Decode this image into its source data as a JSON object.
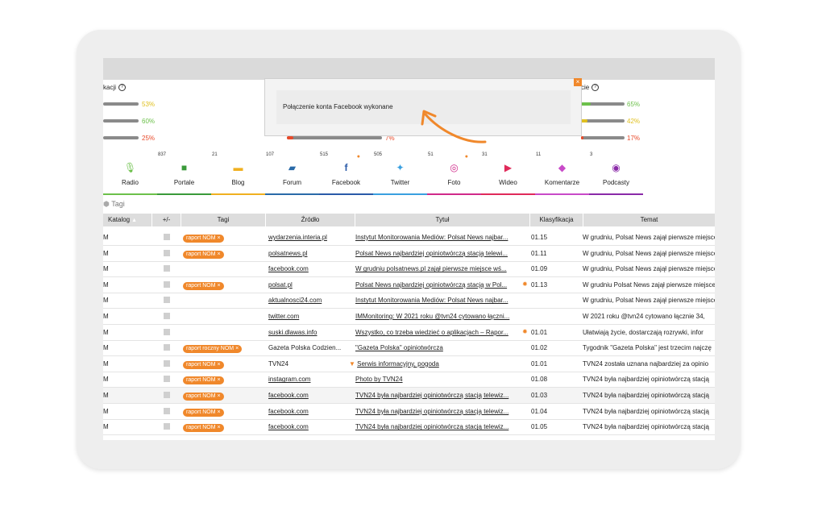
{
  "stats": {
    "left_label": "kacji",
    "right_label": "cie",
    "left_bars": [
      {
        "value": 53,
        "pct": "53%",
        "color": "#e0c020"
      },
      {
        "value": 60,
        "pct": "60%",
        "color": "#6cc04a"
      },
      {
        "value": 25,
        "pct": "25%",
        "color": "#e84a2a"
      }
    ],
    "middle_bar": {
      "value": 7,
      "pct": "7%",
      "color": "#e84a2a"
    },
    "right_bars": [
      {
        "value": 65,
        "pct": "65%",
        "color": "#6cc04a"
      },
      {
        "value": 42,
        "pct": "42%",
        "color": "#e0c020"
      },
      {
        "value": 17,
        "pct": "17%",
        "color": "#e84a2a"
      }
    ]
  },
  "modal": {
    "message": "Połączenie konta Facebook wykonane",
    "close": "×"
  },
  "tabs": [
    {
      "label": "Radio",
      "count": "",
      "icon": "microphone-icon",
      "glyph": "🎙",
      "color": "#6cc04a"
    },
    {
      "label": "Portale",
      "count": "837",
      "icon": "cube-icon",
      "glyph": "■",
      "color": "#3a9a3a"
    },
    {
      "label": "Blog",
      "count": "21",
      "icon": "chat-bubble-icon",
      "glyph": "▬",
      "color": "#f0b020"
    },
    {
      "label": "Forum",
      "count": "107",
      "icon": "forum-icon",
      "glyph": "▰",
      "color": "#2a6aa8"
    },
    {
      "label": "Facebook",
      "count": "515",
      "icon": "facebook-icon",
      "glyph": "f",
      "color": "#2a5aa8"
    },
    {
      "label": "Twitter",
      "count": "505",
      "icon": "twitter-icon",
      "glyph": "✦",
      "color": "#3aa0e0"
    },
    {
      "label": "Foto",
      "count": "51",
      "icon": "instagram-icon",
      "glyph": "◎",
      "color": "#d02a8a"
    },
    {
      "label": "Wideo",
      "count": "31",
      "icon": "play-icon",
      "glyph": "▶",
      "color": "#e02a5a"
    },
    {
      "label": "Komentarze",
      "count": "11",
      "icon": "eraser-icon",
      "glyph": "◆",
      "color": "#c84ac8"
    },
    {
      "label": "Podcasty",
      "count": "3",
      "icon": "podcast-icon",
      "glyph": "◉",
      "color": "#8a2aa8"
    }
  ],
  "tags_label": "Tagi",
  "columns": [
    "Katalog",
    "+/-",
    "Tagi",
    "Źródło",
    "Tytuł",
    "Klasyfikacja",
    "Temat"
  ],
  "rows": [
    {
      "cat": "M",
      "tag": "raport NOM",
      "source": "wydarzenia.interia.pl",
      "title": "Instytut Monitorowania Mediów: Polsat News najbar...",
      "cls": "01.15",
      "topic": "W grudniu, Polsat News zajął pierwsze miejsce",
      "star": false,
      "title_icon": false
    },
    {
      "cat": "M",
      "tag": "raport NOM",
      "source": "polsatnews.pl",
      "title": "Polsat News najbardziej opiniotwórczą stacją telewi...",
      "cls": "01.11",
      "topic": "W grudniu, Polsat News zajął pierwsze miejsce",
      "star": false,
      "title_icon": false
    },
    {
      "cat": "M",
      "tag": "",
      "source": "facebook.com",
      "title": "W grudniu polsatnews.pl zajął pierwsze miejsce wś...",
      "cls": "01.09",
      "topic": "W grudniu, Polsat News zajął pierwsze miejsce",
      "star": false,
      "title_icon": false
    },
    {
      "cat": "M",
      "tag": "raport NOM",
      "source": "polsat.pl",
      "title": "Polsat News najbardziej opiniotwórczą stacją w Pol...",
      "cls": "01.13",
      "topic": "W grudniu Polsat News zajął pierwsze miejsce",
      "star": true,
      "title_icon": false
    },
    {
      "cat": "M",
      "tag": "",
      "source": "aktualnosci24.com",
      "title": "Instytut Monitorowania Mediów: Polsat News najbar...",
      "cls": "",
      "topic": "W grudniu, Polsat News zajął pierwsze miejsce",
      "star": false,
      "title_icon": false
    },
    {
      "cat": "M",
      "tag": "",
      "source": "twitter.com",
      "title": "IMMonitoring: W 2021 roku @tvn24 cytowano łączni...",
      "cls": "",
      "topic": "W 2021 roku @tvn24 cytowano łącznie 34,",
      "star": false,
      "title_icon": false
    },
    {
      "cat": "M",
      "tag": "",
      "source": "suski.dlawas.info",
      "title": "Wszystko, co trzeba wiedzieć o aplikacjach – Rapor...",
      "cls": "01.01",
      "topic": "Ułatwiają życie, dostarczają rozrywki, infor",
      "star": true,
      "title_icon": false
    },
    {
      "cat": "M",
      "tag": "raport roczny NOM",
      "source": "Gazeta Polska Codzien...",
      "title": "\"Gazeta Polska\" opiniotwórcza",
      "cls": "01.02",
      "topic": "Tygodnik \"Gazeta Polska\" jest trzecim najczę",
      "star": false,
      "title_icon": false,
      "plain_source": true
    },
    {
      "cat": "M",
      "tag": "raport NOM",
      "source": "TVN24",
      "title": "Serwis informacyjny, pogoda",
      "cls": "01.01",
      "topic": "TVN24 została uznana najbardziej za opinio",
      "star": false,
      "title_icon": true,
      "plain_source": true
    },
    {
      "cat": "M",
      "tag": "raport NOM",
      "source": "instagram.com",
      "title": "Photo by TVN24",
      "cls": "01.08",
      "topic": "TVN24 była najbardziej opiniotwórczą stacją",
      "star": false,
      "title_icon": false
    },
    {
      "cat": "M",
      "tag": "raport NOM",
      "source": "facebook.com",
      "title": "TVN24 była najbardziej opiniotwórczą stacją telewiz...",
      "cls": "01.03",
      "topic": "TVN24 była najbardziej opiniotwórczą stacją",
      "star": false,
      "title_icon": false,
      "alt": true
    },
    {
      "cat": "M",
      "tag": "raport NOM",
      "source": "facebook.com",
      "title": "TVN24 była najbardziej opiniotwórczą stacją telewiz...",
      "cls": "01.04",
      "topic": "TVN24 była najbardziej opiniotwórczą stacją",
      "star": false,
      "title_icon": false
    },
    {
      "cat": "M",
      "tag": "raport NOM",
      "source": "facebook.com",
      "title": "TVN24 była najbardziej opiniotwórczą stacją telewiz...",
      "cls": "01.05",
      "topic": "TVN24 była najbardziej opiniotwórczą stacją",
      "star": false,
      "title_icon": false
    }
  ]
}
